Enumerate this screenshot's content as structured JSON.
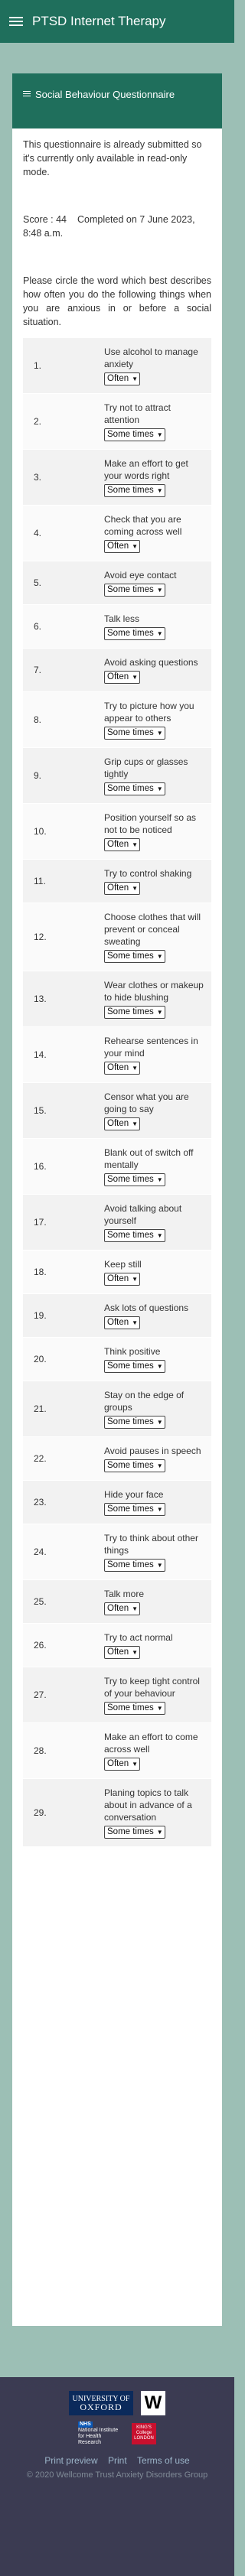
{
  "app": {
    "title": "PTSD Internet Therapy"
  },
  "card": {
    "title": "Social Behaviour Questionnaire",
    "notice": "This questionnaire is already submitted so it's currently only available in read-only mode.",
    "score": "Score : 44",
    "completed": "Completed on 7 June 2023, 8:48 a.m.",
    "instructions": "Please circle the word which best describes how often you do the following things when you are anxious in or before a social situation."
  },
  "questions": [
    {
      "num": "1.",
      "text": "Use alcohol to manage anxiety",
      "answer": "Often"
    },
    {
      "num": "2.",
      "text": "Try not to attract attention",
      "answer": "Some times"
    },
    {
      "num": "3.",
      "text": "Make an effort to get your words right",
      "answer": "Some times"
    },
    {
      "num": "4.",
      "text": "Check that you are coming across well",
      "answer": "Often"
    },
    {
      "num": "5.",
      "text": "Avoid eye contact",
      "answer": "Some times"
    },
    {
      "num": "6.",
      "text": "Talk less",
      "answer": "Some times"
    },
    {
      "num": "7.",
      "text": "Avoid asking questions",
      "answer": "Often"
    },
    {
      "num": "8.",
      "text": "Try to picture how you appear to others",
      "answer": "Some times"
    },
    {
      "num": "9.",
      "text": "Grip cups or glasses tightly",
      "answer": "Some times"
    },
    {
      "num": "10.",
      "text": "Position yourself so as not to be noticed",
      "answer": "Often"
    },
    {
      "num": "11.",
      "text": "Try to control shaking",
      "answer": "Often"
    },
    {
      "num": "12.",
      "text": "Choose clothes that will prevent or conceal sweating",
      "answer": "Some times"
    },
    {
      "num": "13.",
      "text": "Wear clothes or makeup to hide blushing",
      "answer": "Some times"
    },
    {
      "num": "14.",
      "text": "Rehearse sentences in your mind",
      "answer": "Often"
    },
    {
      "num": "15.",
      "text": "Censor what you are going to say",
      "answer": "Often"
    },
    {
      "num": "16.",
      "text": "Blank out of switch off mentally",
      "answer": "Some times"
    },
    {
      "num": "17.",
      "text": "Avoid talking about yourself",
      "answer": "Some times"
    },
    {
      "num": "18.",
      "text": "Keep still",
      "answer": "Often"
    },
    {
      "num": "19.",
      "text": "Ask lots of questions",
      "answer": "Often"
    },
    {
      "num": "20.",
      "text": "Think positive",
      "answer": "Some times"
    },
    {
      "num": "21.",
      "text": "Stay on the edge of groups",
      "answer": "Some times"
    },
    {
      "num": "22.",
      "text": "Avoid pauses in speech",
      "answer": "Some times"
    },
    {
      "num": "23.",
      "text": "Hide your face",
      "answer": "Some times"
    },
    {
      "num": "24.",
      "text": "Try to think about other things",
      "answer": "Some times"
    },
    {
      "num": "25.",
      "text": "Talk more",
      "answer": "Often"
    },
    {
      "num": "26.",
      "text": "Try to act normal",
      "answer": "Often"
    },
    {
      "num": "27.",
      "text": "Try to keep tight control of your behaviour",
      "answer": "Some times"
    },
    {
      "num": "28.",
      "text": "Make an effort to come across well",
      "answer": "Often"
    },
    {
      "num": "29.",
      "text": "Planing topics to talk about in advance of a conversation",
      "answer": "Some times"
    }
  ],
  "footer": {
    "oxford_line1": "UNIVERSITY OF",
    "oxford_line2": "OXFORD",
    "wellcome": "W",
    "nhs": "NHS",
    "nihr": "National Institute for Health Research",
    "kings": "KING'S College LONDON",
    "links": [
      "Print preview",
      "Print",
      "Terms of use"
    ],
    "copyright": "© 2020 Wellcome Trust Anxiety Disorders Group"
  },
  "colors": {
    "brand": "#1f6f5c",
    "page_bg": "#9cbfb5",
    "footer_bg": "#3b3b52",
    "link": "#9cb5c9"
  }
}
